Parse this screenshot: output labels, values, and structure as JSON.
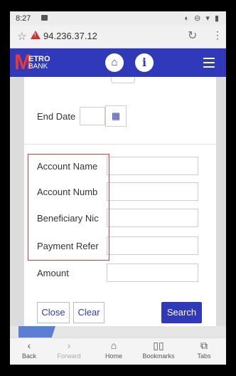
{
  "status_bar": {
    "time": "8:27",
    "icons_right": "◐ ⊖ ▾ ▮"
  },
  "browser": {
    "url": "94.236.37.12",
    "star_icon": "☆",
    "warning_mark": "!",
    "reload_icon": "↻",
    "menu_icon": "⋮"
  },
  "navbar": {
    "logo_m": "M",
    "logo_top": "ETRO",
    "logo_bottom": "BANK",
    "home_icon": "⌂",
    "info_icon": "i"
  },
  "form": {
    "end_date_label": "End Date",
    "calendar_icon": "▦",
    "fields": [
      {
        "label": "Account Name",
        "value": ""
      },
      {
        "label": "Account Numb",
        "value": ""
      },
      {
        "label": "Beneficiary Nic",
        "value": ""
      },
      {
        "label": "Payment Refer",
        "value": ""
      },
      {
        "label": "Amount",
        "value": ""
      }
    ],
    "close_label": "Close",
    "clear_label": "Clear",
    "search_label": "Search"
  },
  "bottom_nav": [
    {
      "icon": "‹",
      "label": "Back",
      "enabled": true
    },
    {
      "icon": "›",
      "label": "Forward",
      "enabled": false
    },
    {
      "icon": "⌂",
      "label": "Home",
      "enabled": true
    },
    {
      "icon": "▯▯",
      "label": "Bookmarks",
      "enabled": true
    },
    {
      "icon": "⧉",
      "label": "Tabs",
      "enabled": true
    }
  ]
}
